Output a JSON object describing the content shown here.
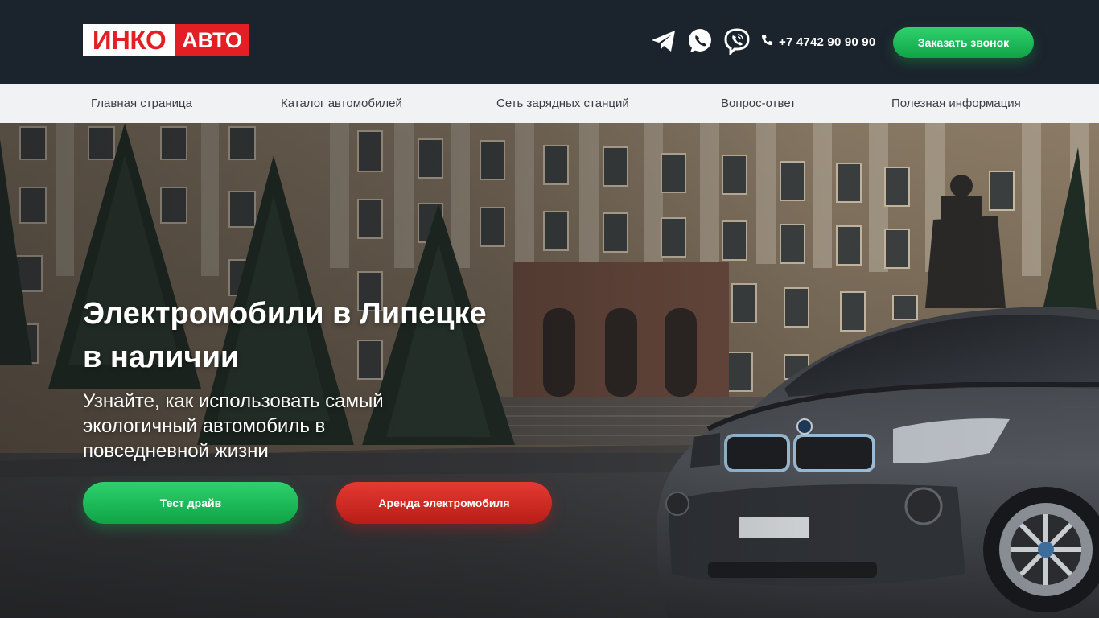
{
  "header": {
    "logo": {
      "part1": "ИНКО",
      "part2": "АВТО"
    },
    "social_icons": [
      "telegram-icon",
      "whatsapp-icon",
      "viber-icon"
    ],
    "phone_icon": "phone-icon",
    "phone": "+7 4742 90 90 90",
    "call_button": "Заказать звонок"
  },
  "nav": {
    "items": [
      {
        "label": "Главная страница"
      },
      {
        "label": "Каталог автомобилей"
      },
      {
        "label": "Сеть зарядных станций"
      },
      {
        "label": "Вопрос-ответ"
      },
      {
        "label": "Полезная информация"
      }
    ]
  },
  "hero": {
    "title_line1": "Электромобили в Липецке",
    "title_line2": "в наличии",
    "subtitle": "Узнайте, как использовать самый экологичный автомобиль в повседневной жизни",
    "button_primary": "Тест драйв",
    "button_secondary": "Аренда электромобиля"
  },
  "colors": {
    "header_bg": "#1b232c",
    "brand_red": "#e31e24",
    "accent_green": "#1fbf5c",
    "nav_bg": "#f1f2f4"
  }
}
